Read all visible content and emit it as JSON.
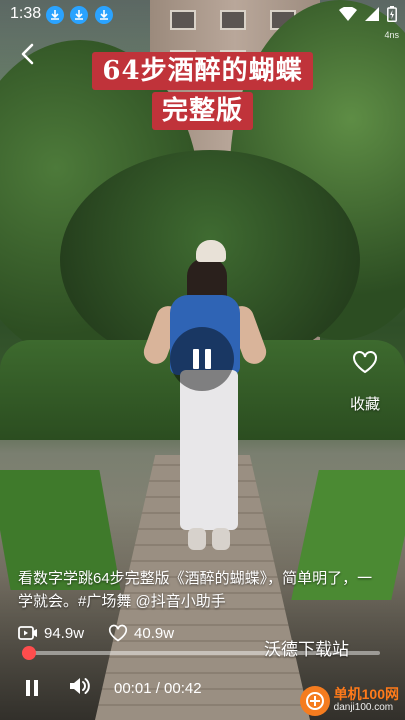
{
  "status_bar": {
    "time": "1:38",
    "net_speed": "4ns",
    "download_icons": [
      "download-icon",
      "download-icon",
      "download-icon"
    ]
  },
  "video": {
    "title_line1": "64步酒醉的蝴蝶",
    "title_line2": "完整版",
    "description": "看数字学跳64步完整版《酒醉的蝴蝶》，简单明了，一学就会。#广场舞 @抖音小助手",
    "plays": "94.9w",
    "likes": "40.9w",
    "favorite_label": "收藏",
    "progress": 0.02,
    "current_time": "00:01",
    "duration": "00:42",
    "time_display": "00:01 / 00:42"
  },
  "watermarks": {
    "site1": "沃德下载站",
    "site2_name": "单机100网",
    "site2_url": "danji100.com"
  },
  "colors": {
    "title_bg": "#c0333a",
    "progress": "#ff4d4d",
    "download_icon": "#2aa3ff"
  }
}
